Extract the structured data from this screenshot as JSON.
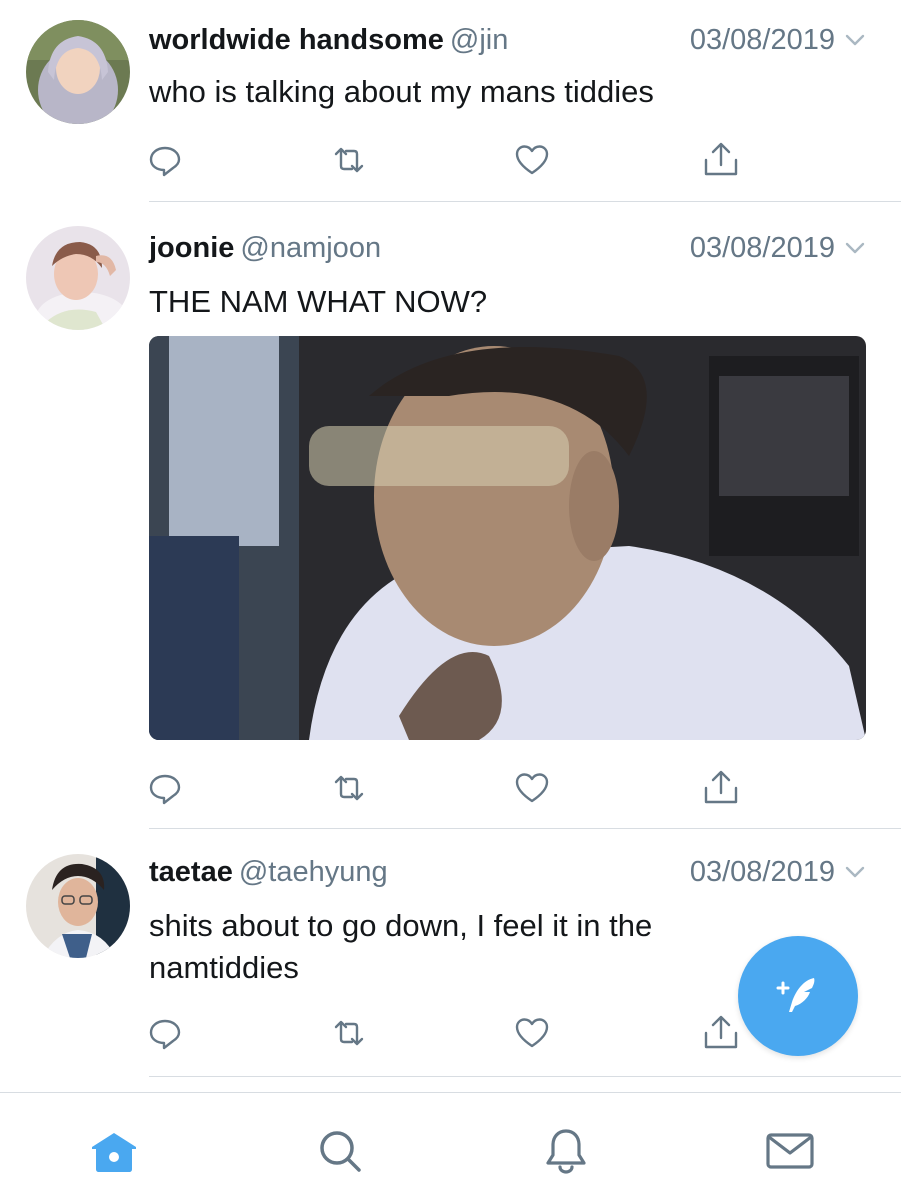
{
  "colors": {
    "accent": "#4aa8f0",
    "text": "#14171a",
    "secondary": "#657786",
    "divider": "#d8dde2"
  },
  "tweets": [
    {
      "display_name": "worldwide handsome",
      "handle": "@jin",
      "date": "03/08/2019",
      "text": "who is talking about my mans tiddies",
      "has_media": false
    },
    {
      "display_name": "joonie",
      "handle": "@namjoon",
      "date": "03/08/2019",
      "text": "THE NAM WHAT NOW?",
      "has_media": true
    },
    {
      "display_name": "taetae",
      "handle": "@taehyung",
      "date": "03/08/2019",
      "text": "shits about to go down, I feel it in the namtiddies",
      "has_media": false
    }
  ],
  "action_icons": [
    "reply-icon",
    "retweet-icon",
    "like-icon",
    "share-icon"
  ],
  "fab": {
    "icon": "compose-tweet-icon"
  },
  "tabbar": {
    "tabs": [
      {
        "icon": "home-icon",
        "active": true
      },
      {
        "icon": "search-icon",
        "active": false
      },
      {
        "icon": "notifications-icon",
        "active": false
      },
      {
        "icon": "messages-icon",
        "active": false
      }
    ]
  }
}
